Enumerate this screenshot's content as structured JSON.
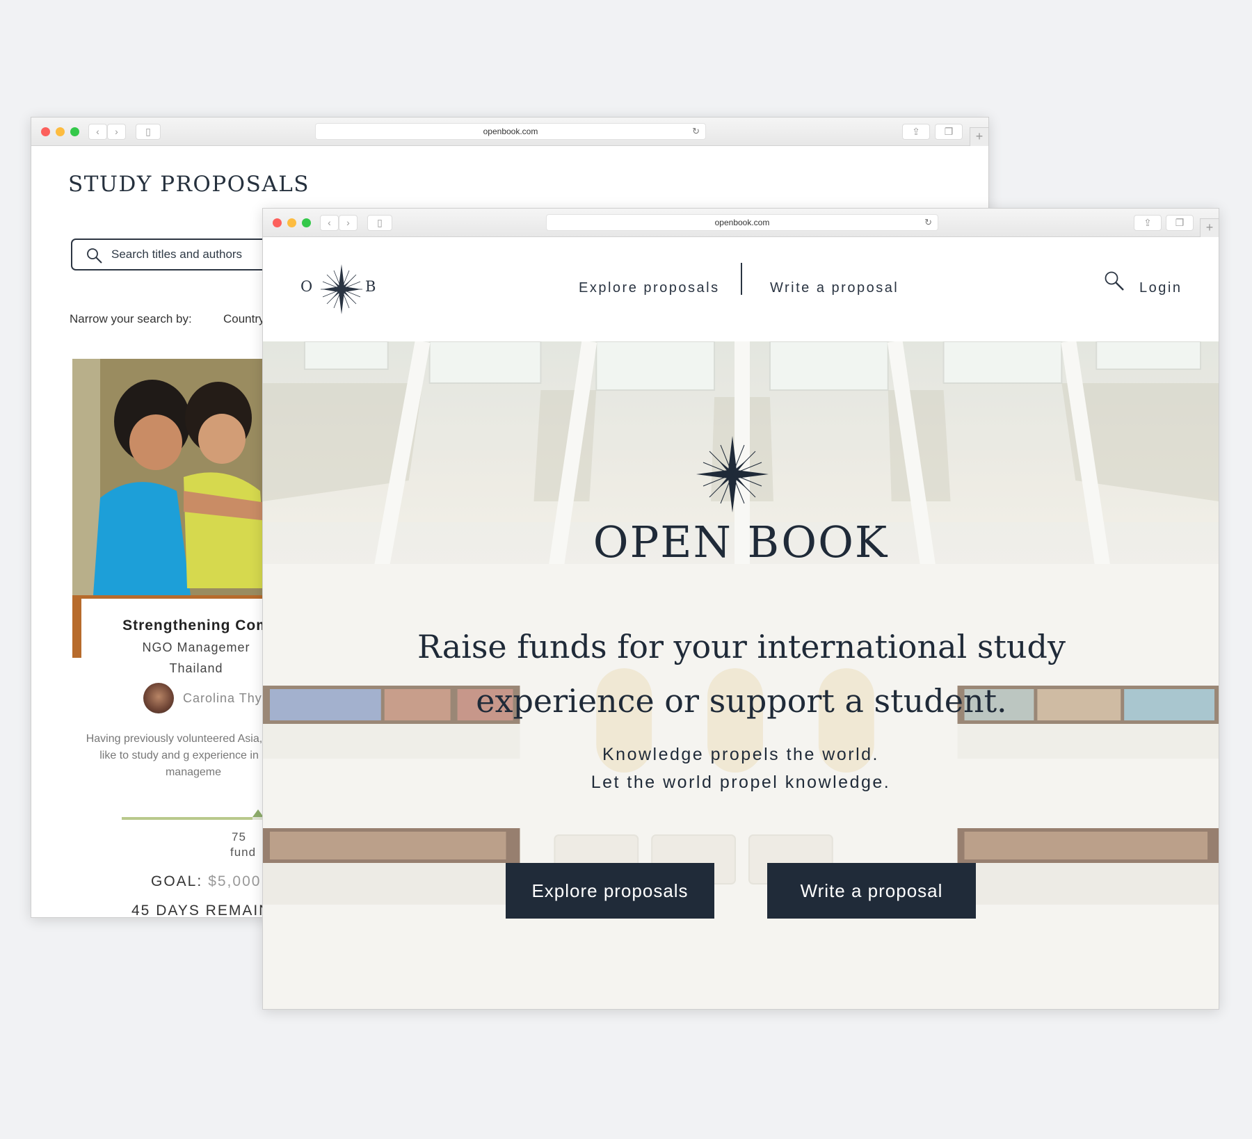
{
  "back_window": {
    "url": "openbook.com",
    "page_title": "STUDY PROPOSALS",
    "search_placeholder": "Search titles and authors",
    "narrow_label": "Narrow your search by:",
    "filter_country": "Country",
    "card": {
      "title": "Strengthening Com",
      "subtitle": "NGO Managemer",
      "location": "Thailand",
      "author": "Carolina Thy",
      "description": "Having previously volunteered Asia, I would like to study and g experience in NGO manageme",
      "percent": "75",
      "funded_label": "fund",
      "goal_label": "GOAL:",
      "goal_value": "$5,000",
      "days_remaining": "45 DAYS REMAIN",
      "progress_fraction": 0.75
    }
  },
  "front_window": {
    "url": "openbook.com",
    "logo_left": "O",
    "logo_right": "B",
    "nav": {
      "explore": "Explore proposals",
      "write": "Write a proposal",
      "login": "Login"
    },
    "hero": {
      "title": "OPEN BOOK",
      "heading": "Raise funds for your international study experience or support a student.",
      "tagline_1": "Knowledge propels the world.",
      "tagline_2": "Let the world propel knowledge.",
      "cta_explore": "Explore proposals",
      "cta_write": "Write a proposal"
    }
  },
  "icons": {
    "compass": "compass-star-icon",
    "search": "search-icon",
    "reload": "reload-icon",
    "share": "share-icon",
    "tabs": "tabs-icon",
    "sidebar": "sidebar-icon"
  },
  "colors": {
    "navy": "#202b39",
    "text_dark": "#1f2a38",
    "progress_green": "#b9c98c",
    "page_bg": "#f1f2f4"
  }
}
